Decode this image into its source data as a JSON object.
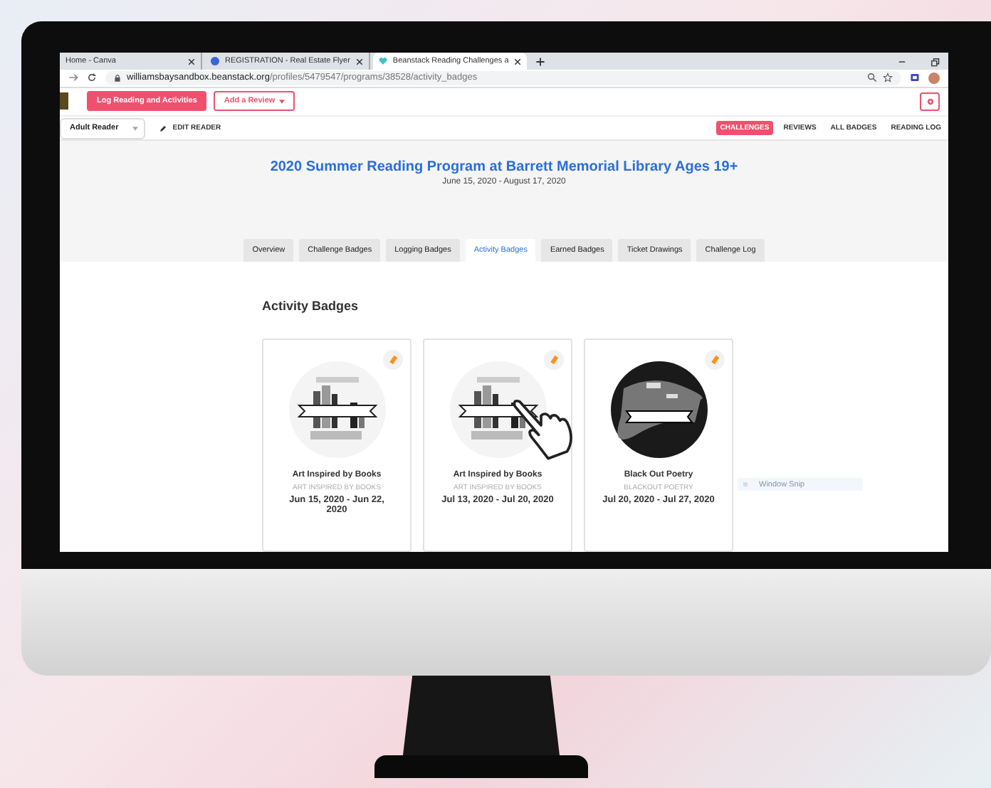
{
  "browser": {
    "tabs": [
      {
        "title": "Home - Canva",
        "selected": false
      },
      {
        "title": "REGISTRATION - Real Estate Flyer",
        "selected": false
      },
      {
        "title": "Beanstack Reading Challenges a",
        "selected": true
      }
    ],
    "url_host": "williamsbaysandbox.beanstack.org",
    "url_path": "/profiles/5479547/programs/38528/activity_badges"
  },
  "header": {
    "buttons": [
      {
        "label": "Log Reading and Activities",
        "kind": "primary"
      },
      {
        "label": "Add a Review",
        "kind": "outline"
      }
    ]
  },
  "reader": {
    "name": "Adult Reader",
    "edit": "EDIT READER",
    "nav": [
      {
        "label": "CHALLENGES",
        "selected": true
      },
      {
        "label": "REVIEWS",
        "selected": false
      },
      {
        "label": "ALL BADGES",
        "selected": false
      },
      {
        "label": "READING LOG",
        "selected": false
      }
    ]
  },
  "program": {
    "title": "2020 Summer Reading Program at Barrett Memorial Library Ages 19+",
    "dates": "June 15, 2020 - August 17, 2020",
    "tabs": [
      {
        "label": "Overview",
        "selected": false
      },
      {
        "label": "Challenge Badges",
        "selected": false
      },
      {
        "label": "Logging Badges",
        "selected": false
      },
      {
        "label": "Activity Badges",
        "selected": true
      },
      {
        "label": "Earned Badges",
        "selected": false
      },
      {
        "label": "Ticket Drawings",
        "selected": false
      },
      {
        "label": "Challenge Log",
        "selected": false
      }
    ]
  },
  "section": {
    "heading": "Activity Badges",
    "badges": [
      {
        "name": "Art Inspired by Books",
        "subtitle": "ART INSPIRED BY BOOKS",
        "dates": "Jun 15, 2020 - Jun 22, 2020",
        "kind": "books"
      },
      {
        "name": "Art Inspired by Books",
        "subtitle": "ART INSPIRED BY BOOKS",
        "dates": "Jul 13, 2020 - Jul 20, 2020",
        "kind": "books"
      },
      {
        "name": "Black Out Poetry",
        "subtitle": "BLACKOUT POETRY",
        "dates": "Jul 20, 2020 - Jul 27, 2020",
        "kind": "poetry"
      }
    ]
  },
  "tooltip": {
    "label": "Window Snip"
  }
}
